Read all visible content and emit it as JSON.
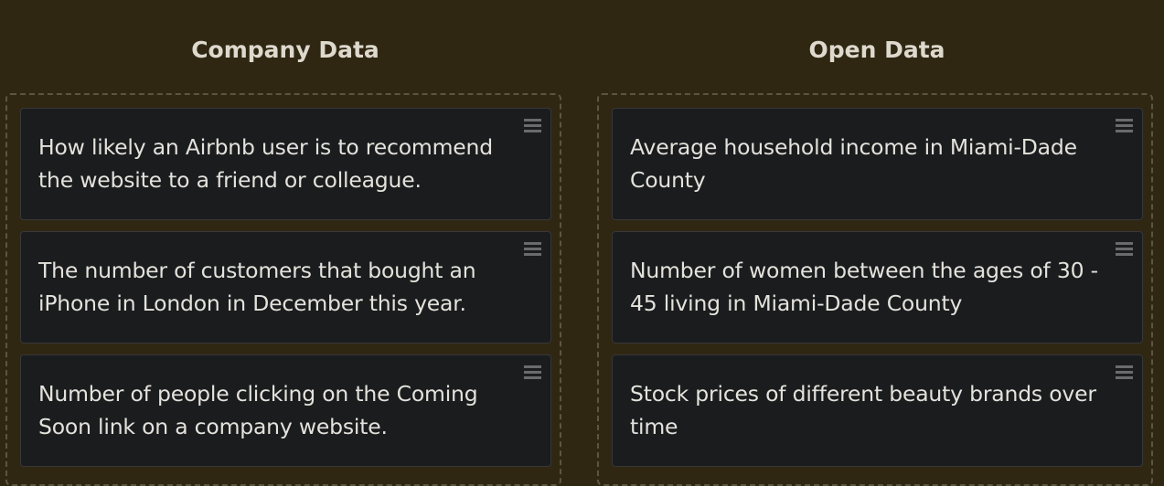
{
  "columns": [
    {
      "title": "Company Data",
      "cards": [
        {
          "text": "How likely an Airbnb user is to recommend the website to a friend or colleague.",
          "handle_icon": "hamburger-icon"
        },
        {
          "text": "The number of customers that bought an iPhone in London in December this year.",
          "handle_icon": "hamburger-icon"
        },
        {
          "text": "Number of people clicking on the Coming Soon link on a company website.",
          "handle_icon": "hamburger-icon"
        }
      ]
    },
    {
      "title": "Open Data",
      "cards": [
        {
          "text": "Average household income in Miami-Dade County",
          "handle_icon": "hamburger-icon"
        },
        {
          "text": "Number of women between the ages of 30 - 45 living in Miami-Dade County",
          "handle_icon": "hamburger-icon"
        },
        {
          "text": "Stock prices of different beauty brands over time",
          "handle_icon": "hamburger-icon"
        }
      ]
    }
  ],
  "colors": {
    "background": "#302713",
    "card_background": "#1b1c1e",
    "text": "#e4e2dc",
    "dashed_border": "#5d5543",
    "handle": "#6b6b6e"
  }
}
